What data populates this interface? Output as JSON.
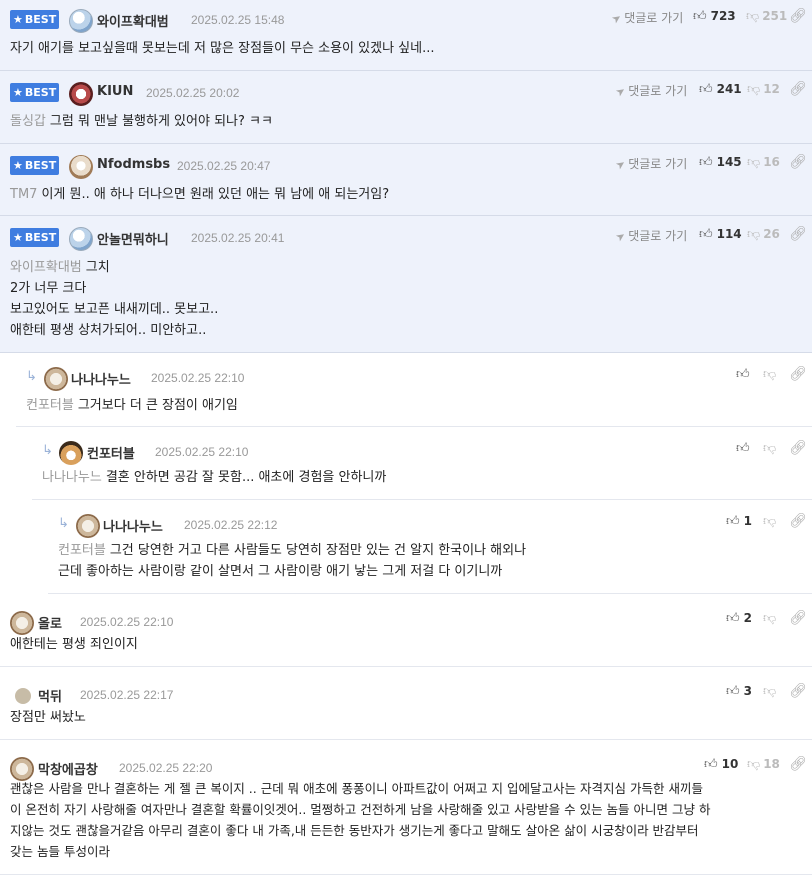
{
  "labels": {
    "best": "BEST",
    "goto": "댓글로 가기"
  },
  "comments": [
    {
      "best": true,
      "avatar": "seal-avatar",
      "nick": "와이프확대범",
      "date": "2025.02.25 15:48",
      "up": "723",
      "down": "251",
      "mention": "",
      "lines": [
        "자기 애기를 보고싶을때 못보는데 저 많은 장점들이 무슨 소용이 있겠나 싶네..."
      ]
    },
    {
      "best": true,
      "avatar": "red-dog-avatar",
      "nick": "KIUN",
      "date": "2025.02.25 20:02",
      "up": "241",
      "down": "12",
      "mention": "돌싱갑",
      "lines": [
        "그럼 뭐 맨날 불행하게 있어야 되나? ㅋㅋ"
      ]
    },
    {
      "best": true,
      "avatar": "dog-avatar",
      "nick": "Nfodmsbs",
      "date": "2025.02.25 20:47",
      "up": "145",
      "down": "16",
      "mention": "TM7",
      "lines": [
        "이게 뭔.. 애 하나 더나으면 원래 있던 애는 뭐 남에 애 되는거임?"
      ]
    },
    {
      "best": true,
      "avatar": "seal-avatar",
      "nick": "안놀면뭐하니",
      "date": "2025.02.25 20:41",
      "up": "114",
      "down": "26",
      "mention": "와이프확대범",
      "lines": [
        "그치",
        "2가 너무 크다",
        "보고있어도 보고픈 내새끼데.. 못보고..",
        "애한테 평생 상처가되어.. 미안하고.."
      ]
    },
    {
      "best": false,
      "avatar": "dog-avatar",
      "nick": "나나나누느",
      "date": "2025.02.25 22:10",
      "up": "",
      "down": "",
      "mention": "컨포터블",
      "lines": [
        "그거보다 더 큰 장점이 애기임"
      ]
    },
    {
      "best": false,
      "avatar": "fox-avatar",
      "nick": "컨포터블",
      "date": "2025.02.25 22:10",
      "up": "",
      "down": "",
      "mention": "나나나누느",
      "lines": [
        "결혼 안하면 공감 잘 못함... 애초에 경험을 안하니까"
      ]
    },
    {
      "best": false,
      "avatar": "dog-avatar",
      "nick": "나나나누느",
      "date": "2025.02.25 22:12",
      "up": "1",
      "down": "",
      "mention": "컨포터블",
      "lines": [
        "그건 당연한 거고 다른 사람들도 당연히 장점만 있는 건 알지 한국이나 해외나",
        "근데 좋아하는 사람이랑 같이 살면서 그 사람이랑 애기 낳는 그게 저걸 다 이기니까"
      ]
    },
    {
      "best": false,
      "avatar": "dog-avatar",
      "nick": "올로",
      "date": "2025.02.25 22:10",
      "up": "2",
      "down": "",
      "mention": "",
      "lines": [
        "애한테는 평생 죄인이지"
      ]
    },
    {
      "best": false,
      "avatar": "grey-avatar",
      "nick": "먹뒤",
      "date": "2025.02.25 22:17",
      "up": "3",
      "down": "",
      "mention": "",
      "lines": [
        "장점만 써놨노"
      ]
    },
    {
      "best": false,
      "avatar": "dog-avatar",
      "nick": "막창에곱창",
      "date": "2025.02.25 22:20",
      "up": "10",
      "down": "18",
      "mention": "",
      "lines": [
        "괜찮은 사람을 만나 결혼하는 게 젤 큰 복이지 .. 근데 뭐 애초에 퐁퐁이니 아파트값이 어쩌고 지 입에달고사는 자격지심 가득한 새끼들",
        "이 온전히 자기 사랑해줄 여자만나 결혼할 확률이잇겟어.. 멀쩡하고 건전하게 남을 사랑해줄 있고 사랑받을 수 있는 놈들 아니면 그냥 하",
        "지않는 것도 괜찮을거같음 아무리 결혼이 좋다 내 가족,내 든든한 동반자가 생기는게 좋다고 말해도 살아온 삶이 시궁창이라 반감부터",
        "갖는 놈들 투성이라"
      ]
    }
  ]
}
